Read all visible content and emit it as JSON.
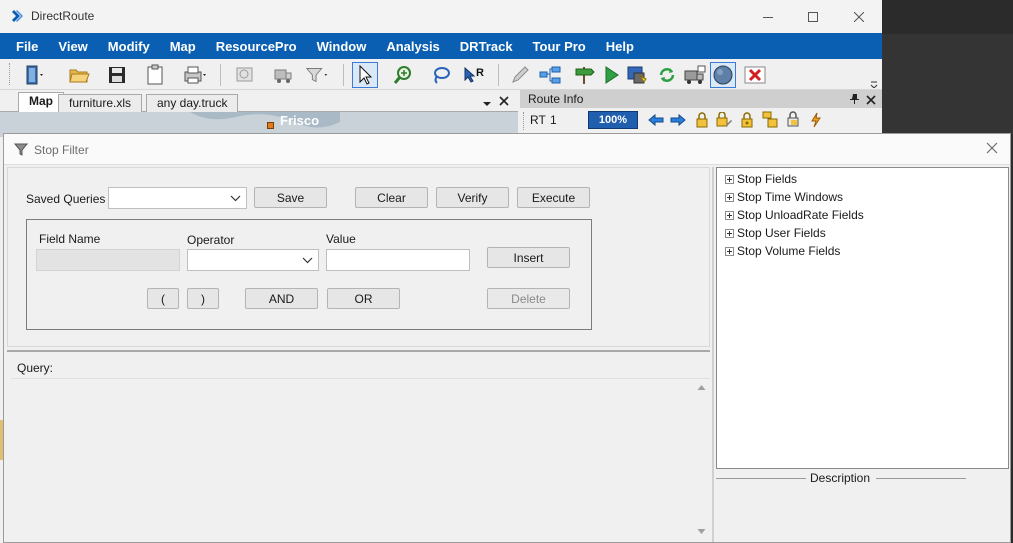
{
  "app": {
    "title": "DirectRoute"
  },
  "menu": [
    "File",
    "View",
    "Modify",
    "Map",
    "ResourcePro",
    "Window",
    "Analysis",
    "DRTrack",
    "Tour Pro",
    "Help"
  ],
  "doc_tabs": [
    "Map",
    "furniture.xls",
    "any day.truck"
  ],
  "map": {
    "place_label": "Frisco"
  },
  "route_info": {
    "title": "Route Info",
    "route_label": "RT",
    "route_value": "1",
    "zoom": "100%"
  },
  "stop_filter": {
    "title": "Stop Filter",
    "saved_queries_label": "Saved Queries",
    "saved_queries_value": "",
    "buttons": {
      "save": "Save",
      "clear": "Clear",
      "verify": "Verify",
      "execute": "Execute",
      "insert": "Insert",
      "open_paren": "(",
      "close_paren": ")",
      "and": "AND",
      "or": "OR",
      "delete": "Delete"
    },
    "field_name_label": "Field Name",
    "operator_label": "Operator",
    "value_label": "Value",
    "query_label": "Query:",
    "query_text": "",
    "tree": [
      "Stop Fields",
      "Stop Time Windows",
      "Stop UnloadRate Fields",
      "Stop User Fields",
      "Stop Volume Fields"
    ],
    "description_label": "Description"
  },
  "colors": {
    "menu_bar": "#0a5fb2",
    "zoom_badge": "#1f5fae"
  },
  "icons": {
    "toolbar": [
      "open-door-icon",
      "folder-open-icon",
      "save-disk-icon",
      "clipboard-icon",
      "print-icon",
      "zoom-preview-icon",
      "truck-icon",
      "filter-funnel-icon",
      "select-pointer-icon",
      "zoom-in-icon",
      "lasso-icon",
      "route-cursor-icon",
      "pencil-icon",
      "hierarchy-icon",
      "signpost-icon",
      "play-icon",
      "stop-monitor-icon",
      "refresh-icon",
      "truck-export-icon",
      "sphere-icon",
      "cancel-icon"
    ],
    "route_info": [
      "arrow-left-icon",
      "arrow-right-icon",
      "lock-icon",
      "lock-pencil-icon",
      "lock-key-icon",
      "lock-stack-icon",
      "lock-refresh-icon",
      "lightning-icon"
    ]
  }
}
